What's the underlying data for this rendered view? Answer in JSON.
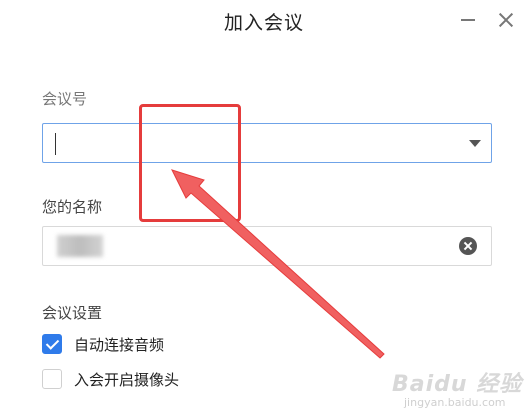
{
  "window": {
    "title": "加入会议"
  },
  "form": {
    "meeting_id": {
      "label": "会议号",
      "value": "",
      "placeholder": ""
    },
    "your_name": {
      "label": "您的名称",
      "value": ""
    },
    "settings": {
      "label": "会议设置",
      "options": [
        {
          "label": "自动连接音频",
          "checked": true
        },
        {
          "label": "入会开启摄像头",
          "checked": false
        }
      ]
    }
  },
  "annotation": {
    "color": "#e53c3c"
  },
  "watermark": {
    "text": "Baidu 经验",
    "sub": "jingyan.baidu.com"
  },
  "colors": {
    "accent": "#2f7bea",
    "focus_border": "#6fa3e8"
  }
}
